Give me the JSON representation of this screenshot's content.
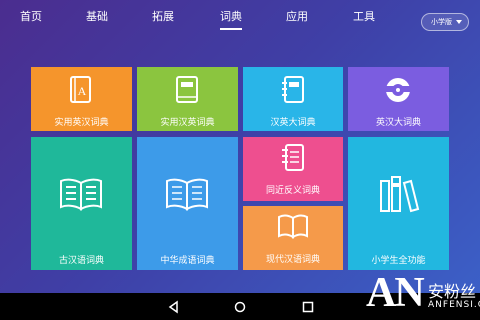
{
  "nav": {
    "tabs": [
      {
        "label": "首页"
      },
      {
        "label": "基础"
      },
      {
        "label": "拓展"
      },
      {
        "label": "词典",
        "active": true
      },
      {
        "label": "应用"
      },
      {
        "label": "工具"
      }
    ],
    "grade_select": "小学版"
  },
  "tiles": {
    "t1": {
      "label": "实用英汉词典",
      "color": "#f5952c",
      "icon": "book-a-icon"
    },
    "t2": {
      "label": "实用汉英词典",
      "color": "#8bc53f",
      "icon": "book-icon"
    },
    "t3": {
      "label": "汉英大词典",
      "color": "#29b5e8",
      "icon": "notebook-icon"
    },
    "t4": {
      "label": "英汉大词典",
      "color": "#7b5de0",
      "icon": "disc-icon"
    },
    "t5": {
      "label": "古汉语词典",
      "color": "#1fb89a",
      "icon": "open-book-icon"
    },
    "t6": {
      "label": "中华成语词典",
      "color": "#3d9be9",
      "icon": "open-book-icon"
    },
    "t7": {
      "label": "同近反义词典",
      "color": "#ee4f8f",
      "icon": "notebook-icon"
    },
    "t8": {
      "label": "现代汉语词典",
      "color": "#f59a4a",
      "icon": "open-book-icon"
    },
    "t9": {
      "label": "小学生全功能",
      "color": "#22b7e0",
      "icon": "books-icon"
    }
  },
  "watermark": {
    "mark": "AN",
    "cn": "安粉丝",
    "en": "ANFENSI.COM"
  }
}
